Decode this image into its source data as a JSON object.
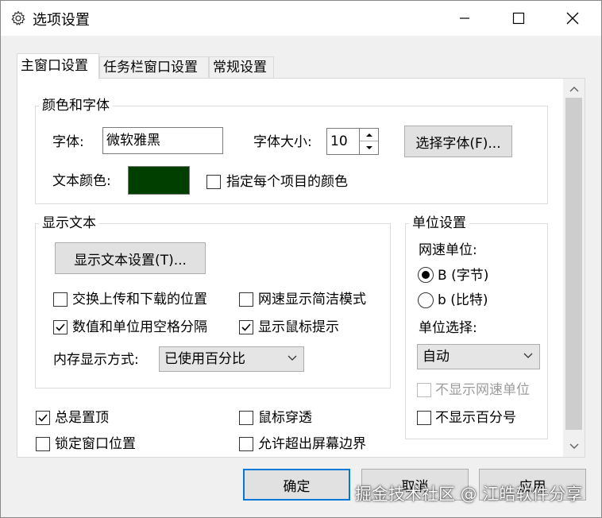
{
  "window": {
    "title": "选项设置",
    "icons": {
      "app": "gear-icon",
      "minimize": "minimize-icon",
      "maximize": "maximize-icon",
      "close": "close-icon"
    }
  },
  "tabs": [
    {
      "label": "主窗口设置",
      "active": true
    },
    {
      "label": "任务栏窗口设置",
      "active": false
    },
    {
      "label": "常规设置",
      "active": false
    }
  ],
  "color_font": {
    "group_title": "颜色和字体",
    "font_label": "字体:",
    "font_value": "微软雅黑",
    "font_size_label": "字体大小:",
    "font_size_value": "10",
    "choose_font_button": "选择字体(F)...",
    "text_color_label": "文本颜色:",
    "text_color": "#003f00",
    "per_item_color_label": "指定每个项目的颜色",
    "per_item_color_checked": false
  },
  "display_text": {
    "group_title": "显示文本",
    "settings_button": "显示文本设置(T)...",
    "swap_up_down": {
      "label": "交换上传和下载的位置",
      "checked": false
    },
    "speed_simple": {
      "label": "网速显示简洁模式",
      "checked": false
    },
    "space_separate": {
      "label": "数值和单位用空格分隔",
      "checked": true
    },
    "mouse_tips": {
      "label": "显示鼠标提示",
      "checked": true
    },
    "memory_mode_label": "内存显示方式:",
    "memory_mode_value": "已使用百分比"
  },
  "unit": {
    "group_title": "单位设置",
    "speed_unit_label": "网速单位:",
    "radio_byte": {
      "label": "B (字节)",
      "selected": true
    },
    "radio_bit": {
      "label": "b (比特)",
      "selected": false
    },
    "unit_select_label": "单位选择:",
    "unit_select_value": "自动",
    "hide_speed_unit": {
      "label": "不显示网速单位",
      "checked": false,
      "disabled": true
    },
    "hide_percent": {
      "label": "不显示百分号",
      "checked": false
    }
  },
  "misc": {
    "always_on_top": {
      "label": "总是置顶",
      "checked": true
    },
    "mouse_through": {
      "label": "鼠标穿透",
      "checked": false
    },
    "lock_position": {
      "label": "锁定窗口位置",
      "checked": false
    },
    "allow_offscreen": {
      "label": "允许超出屏幕边界",
      "checked": false
    }
  },
  "footer": {
    "ok": "确定",
    "cancel": "取消",
    "apply": "应用"
  },
  "watermark": "掘金技术社区 @ 江皓软件分享"
}
